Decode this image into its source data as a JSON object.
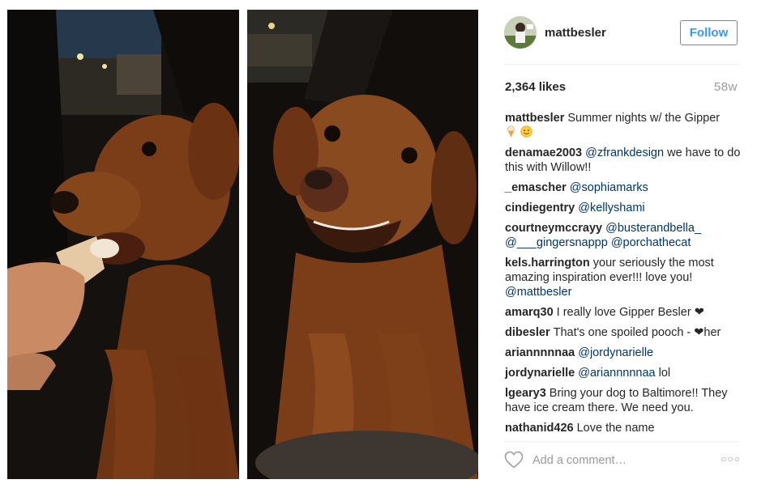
{
  "post": {
    "username": "mattbesler",
    "follow_label": "Follow",
    "likes": "2,364 likes",
    "age": "58w",
    "comment_placeholder": "Add a comment…",
    "more_label": "○○○"
  },
  "comments": [
    {
      "author": "mattbesler",
      "text": "Summer nights w/ the Gipper",
      "emojis": [
        "ice-cream",
        "smiley"
      ]
    },
    {
      "author": "denamae2003",
      "mention": "@zfrankdesign",
      "text": "we have to do this with Willow!!"
    },
    {
      "author": "_emascher",
      "mention": "@sophiamarks"
    },
    {
      "author": "cindiegentry",
      "mention": "@kellyshami"
    },
    {
      "author": "courtneymccrayy",
      "mention": "@busterandbella_",
      "mention2": "@___gingersnappp",
      "mention3": "@porchathecat"
    },
    {
      "author": "kels.harrington",
      "text": "your seriously the most amazing inspiration ever!!! love you!",
      "mention": "@mattbesler"
    },
    {
      "author": "amarq30",
      "text": "I really love Gipper Besler ❤"
    },
    {
      "author": "dibesler",
      "text": "That's one spoiled pooch - ❤her"
    },
    {
      "author": "ariannnnnaa",
      "mention": "@jordynarielle"
    },
    {
      "author": "jordynarielle",
      "mention": "@ariannnnnaa",
      "text": "lol"
    },
    {
      "author": "lgeary3",
      "text": "Bring your dog to Baltimore!! They have ice cream there. We need you."
    },
    {
      "author": "nathanid426",
      "text": "Love the name"
    }
  ],
  "colors": {
    "accent": "#3897f0",
    "mention": "#003569",
    "text": "#262626",
    "muted": "#999999"
  },
  "icons": [
    "heart-icon",
    "more-options-icon"
  ]
}
